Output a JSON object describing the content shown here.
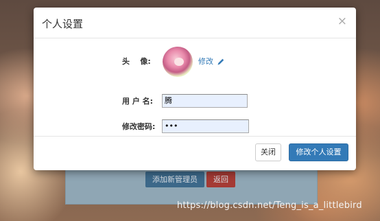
{
  "background": {
    "add_admin_button": "添加新管理员",
    "back_button": "返回"
  },
  "watermark": "https://blog.csdn.net/Teng_is_a_littlebird",
  "modal": {
    "title": "个人设置",
    "close_symbol": "×",
    "avatar_label": "头    像:",
    "edit_link": "修改",
    "username_label": "用 户 名:",
    "username_value": "腾",
    "password_label": "修改密码:",
    "password_value": "•••",
    "close_button": "关闭",
    "save_button": "修改个人设置"
  },
  "colors": {
    "primary": "#337ab7",
    "danger": "#a43a34",
    "input_bg": "#e8f0fe"
  }
}
